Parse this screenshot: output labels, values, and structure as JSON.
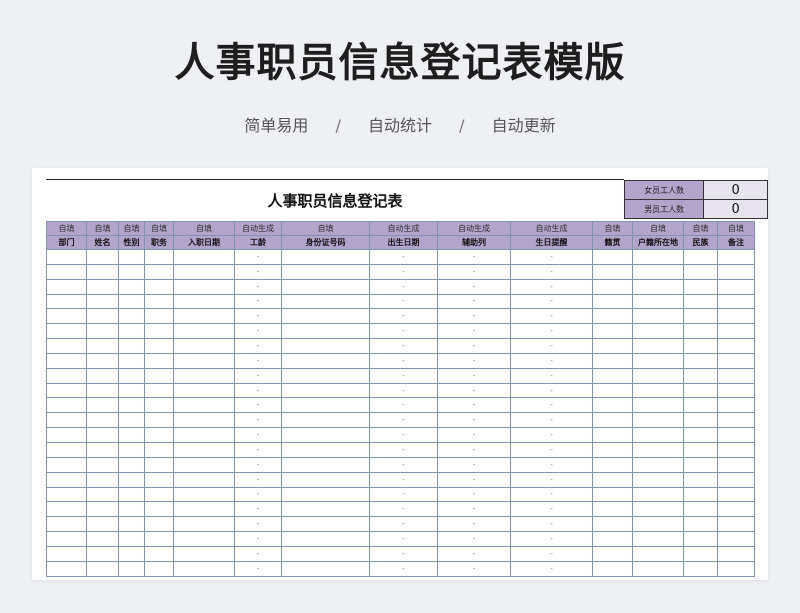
{
  "main_title": "人事职员信息登记表模版",
  "subtitle": {
    "items": [
      "简单易用",
      "自动统计",
      "自动更新"
    ],
    "separator": "/"
  },
  "sheet": {
    "title": "人事职员信息登记表",
    "counts": [
      {
        "label": "女员工人数",
        "value": "0"
      },
      {
        "label": "男员工人数",
        "value": "0"
      }
    ],
    "columns": [
      {
        "hint": "自填",
        "header": "部门"
      },
      {
        "hint": "自填",
        "header": "姓名"
      },
      {
        "hint": "自填",
        "header": "性别"
      },
      {
        "hint": "自填",
        "header": "职务"
      },
      {
        "hint": "自填",
        "header": "入职日期"
      },
      {
        "hint": "自动生成",
        "header": "工龄"
      },
      {
        "hint": "自填",
        "header": "身份证号码"
      },
      {
        "hint": "自动生成",
        "header": "出生日期"
      },
      {
        "hint": "自动生成",
        "header": "辅助列"
      },
      {
        "hint": "自动生成",
        "header": "生日提醒"
      },
      {
        "hint": "自填",
        "header": "籍贯"
      },
      {
        "hint": "自填",
        "header": "户籍所在地"
      },
      {
        "hint": "自填",
        "header": "民族"
      },
      {
        "hint": "自填",
        "header": "备注"
      }
    ],
    "rows": [
      [
        "",
        "",
        "",
        "",
        "",
        "-",
        "",
        "-",
        "-",
        "-",
        "",
        "",
        "",
        ""
      ],
      [
        "",
        "",
        "",
        "",
        "",
        "-",
        "",
        "-",
        "-",
        "-",
        "",
        "",
        "",
        ""
      ],
      [
        "",
        "",
        "",
        "",
        "",
        "-",
        "",
        "-",
        "-",
        "-",
        "",
        "",
        "",
        ""
      ],
      [
        "",
        "",
        "",
        "",
        "",
        "-",
        "",
        "-",
        "-",
        "-",
        "",
        "",
        "",
        ""
      ],
      [
        "",
        "",
        "",
        "",
        "",
        "-",
        "",
        "-",
        "-",
        "-",
        "",
        "",
        "",
        ""
      ],
      [
        "",
        "",
        "",
        "",
        "",
        "-",
        "",
        "-",
        "-",
        "-",
        "",
        "",
        "",
        ""
      ],
      [
        "",
        "",
        "",
        "",
        "",
        "-",
        "",
        "-",
        "-",
        "-",
        "",
        "",
        "",
        ""
      ],
      [
        "",
        "",
        "",
        "",
        "",
        "-",
        "",
        "-",
        "-",
        "-",
        "",
        "",
        "",
        ""
      ],
      [
        "",
        "",
        "",
        "",
        "",
        "-",
        "",
        "-",
        "-",
        "-",
        "",
        "",
        "",
        ""
      ],
      [
        "",
        "",
        "",
        "",
        "",
        "-",
        "",
        "-",
        "-",
        "-",
        "",
        "",
        "",
        ""
      ],
      [
        "",
        "",
        "",
        "",
        "",
        "-",
        "",
        "-",
        "-",
        "-",
        "",
        "",
        "",
        ""
      ],
      [
        "",
        "",
        "",
        "",
        "",
        "-",
        "",
        "-",
        "-",
        "-",
        "",
        "",
        "",
        ""
      ],
      [
        "",
        "",
        "",
        "",
        "",
        "-",
        "",
        "-",
        "-",
        "-",
        "",
        "",
        "",
        ""
      ],
      [
        "",
        "",
        "",
        "",
        "",
        "-",
        "",
        "-",
        "-",
        "-",
        "",
        "",
        "",
        ""
      ],
      [
        "",
        "",
        "",
        "",
        "",
        "-",
        "",
        "-",
        "-",
        "-",
        "",
        "",
        "",
        ""
      ],
      [
        "",
        "",
        "",
        "",
        "",
        "-",
        "",
        "-",
        "-",
        "-",
        "",
        "",
        "",
        ""
      ],
      [
        "",
        "",
        "",
        "",
        "",
        "-",
        "",
        "-",
        "-",
        "-",
        "",
        "",
        "",
        ""
      ],
      [
        "",
        "",
        "",
        "",
        "",
        "-",
        "",
        "-",
        "-",
        "-",
        "",
        "",
        "",
        ""
      ],
      [
        "",
        "",
        "",
        "",
        "",
        "-",
        "",
        "-",
        "-",
        "-",
        "",
        "",
        "",
        ""
      ],
      [
        "",
        "",
        "",
        "",
        "",
        "-",
        "",
        "-",
        "-",
        "-",
        "",
        "",
        "",
        ""
      ],
      [
        "",
        "",
        "",
        "",
        "",
        "-",
        "",
        "-",
        "-",
        "-",
        "",
        "",
        "",
        ""
      ],
      [
        "",
        "",
        "",
        "",
        "",
        "-",
        "",
        "-",
        "-",
        "-",
        "",
        "",
        "",
        ""
      ]
    ]
  },
  "colors": {
    "header_fill": "#b3a4cc",
    "count_value_fill": "#e7e4ef",
    "grid_line": "#7f95b4",
    "page_background": "#eef0f4"
  }
}
